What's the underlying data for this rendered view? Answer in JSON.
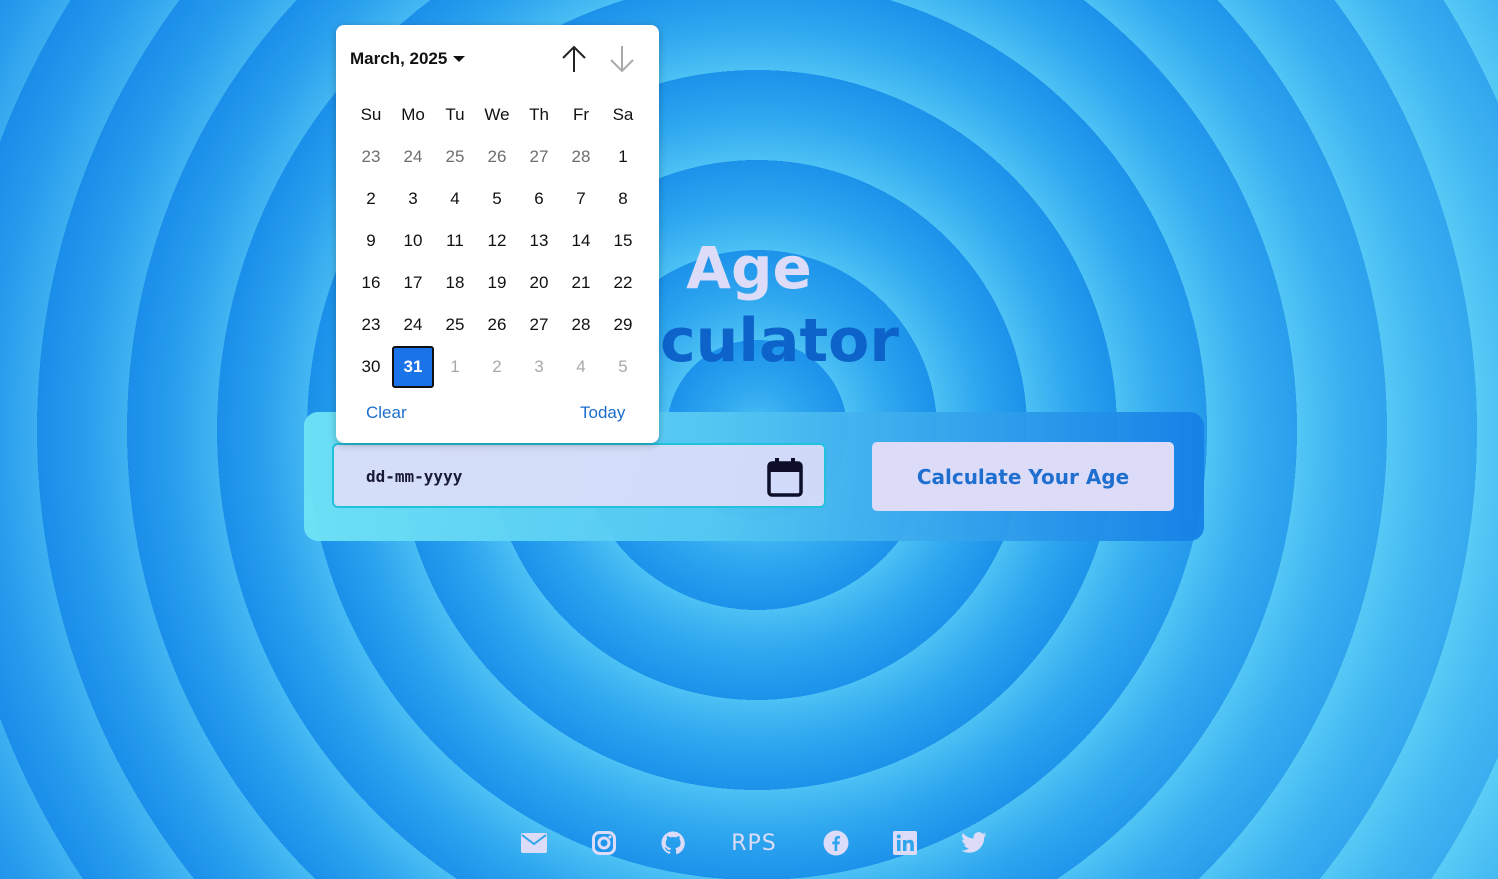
{
  "page": {
    "title_line1": "Age",
    "title_line2": "alculator",
    "colors": {
      "background": "#2ea6ef",
      "title_top": "#dcdcf8",
      "title_bottom": "#0d63c9",
      "button_bg": "#dcdcf8",
      "button_text": "#1f6fd0",
      "selected_day": "#1a73e8"
    }
  },
  "form": {
    "date_placeholder": "dd-mm-yyyy",
    "calendar_icon": "calendar-icon",
    "calculate_label": "Calculate Your Age"
  },
  "datepicker": {
    "month_label": "March, 2025",
    "weekdays": [
      "Su",
      "Mo",
      "Tu",
      "We",
      "Th",
      "Fr",
      "Sa"
    ],
    "weeks": [
      [
        "23",
        "24",
        "25",
        "26",
        "27",
        "28",
        "1"
      ],
      [
        "2",
        "3",
        "4",
        "5",
        "6",
        "7",
        "8"
      ],
      [
        "9",
        "10",
        "11",
        "12",
        "13",
        "14",
        "15"
      ],
      [
        "16",
        "17",
        "18",
        "19",
        "20",
        "21",
        "22"
      ],
      [
        "23",
        "24",
        "25",
        "26",
        "27",
        "28",
        "29"
      ],
      [
        "30",
        "31",
        "1",
        "2",
        "3",
        "4",
        "5"
      ]
    ],
    "selected_day": "31",
    "clear_label": "Clear",
    "today_label": "Today",
    "prev_icon": "arrow-up-icon",
    "next_icon": "arrow-down-icon"
  },
  "footer": {
    "links": [
      {
        "icon": "mail-icon"
      },
      {
        "icon": "instagram-icon"
      },
      {
        "icon": "github-icon"
      },
      {
        "icon": "rps-logo",
        "text": "RPS"
      },
      {
        "icon": "facebook-icon"
      },
      {
        "icon": "linkedin-icon"
      },
      {
        "icon": "twitter-icon"
      }
    ]
  }
}
